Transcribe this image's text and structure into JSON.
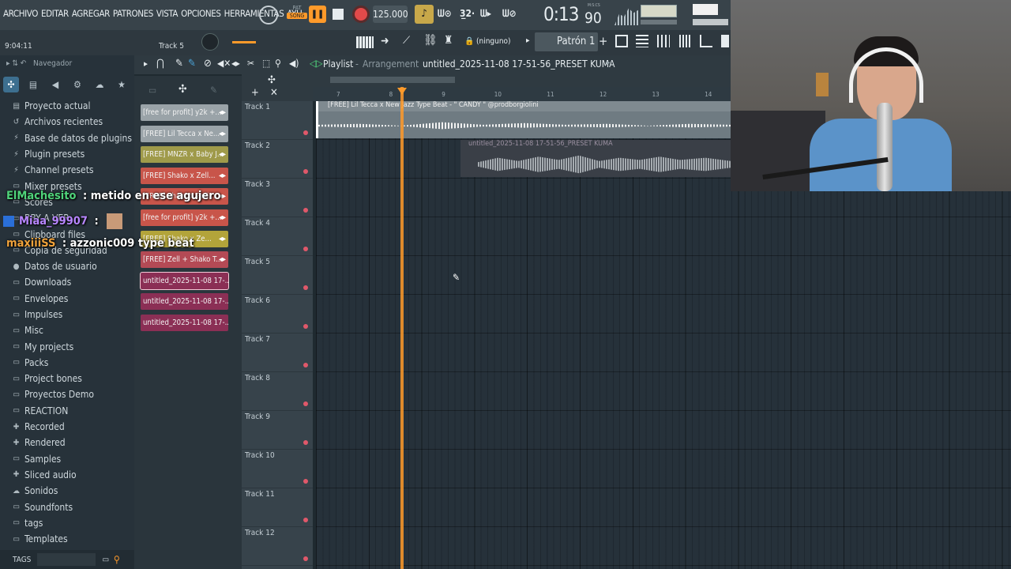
{
  "menu": [
    "ARCHIVO",
    "EDITAR",
    "AGREGAR",
    "PATRONES",
    "VISTA",
    "OPCIONES",
    "HERRAMIENTAS",
    "AYU"
  ],
  "transport": {
    "pat_label": "PAT",
    "song_label": "SONG",
    "tempo": "125.000",
    "time_display": "0:13",
    "time_small": "90",
    "time_unit": "M:S:CS"
  },
  "hint": {
    "time": "9:04:11",
    "track": "Track 5"
  },
  "toolbar": {
    "none_label": "(ninguno)",
    "pattern_label": "Patrón 1"
  },
  "browser": {
    "title": "Navegador",
    "items": [
      {
        "icon": "doc-icon",
        "label": "Proyecto actual"
      },
      {
        "icon": "history-icon",
        "label": "Archivos recientes"
      },
      {
        "icon": "plug-icon",
        "label": "Base de datos de plugins"
      },
      {
        "icon": "plug-icon",
        "label": "Plugin presets"
      },
      {
        "icon": "plug-icon",
        "label": "Channel presets"
      },
      {
        "icon": "folder-icon",
        "label": "Mixer presets"
      },
      {
        "icon": "folder-icon",
        "label": "Scores"
      },
      {
        "icon": "folder-icon",
        "label": "BBY A VER"
      },
      {
        "icon": "folder-icon",
        "label": "Clipboard files"
      },
      {
        "icon": "folder-icon",
        "label": "Copia de seguridad"
      },
      {
        "icon": "user-icon",
        "label": "Datos de usuario"
      },
      {
        "icon": "folder-icon",
        "label": "Downloads"
      },
      {
        "icon": "folder-icon",
        "label": "Envelopes"
      },
      {
        "icon": "folder-icon",
        "label": "Impulses"
      },
      {
        "icon": "folder-icon",
        "label": "Misc"
      },
      {
        "icon": "folder-icon",
        "label": "My projects"
      },
      {
        "icon": "folder-icon",
        "label": "Packs"
      },
      {
        "icon": "folder-icon",
        "label": "Project bones"
      },
      {
        "icon": "folder-icon",
        "label": "Proyectos Demo"
      },
      {
        "icon": "folder-icon",
        "label": "REACTION"
      },
      {
        "icon": "plus-icon",
        "label": "Recorded"
      },
      {
        "icon": "plus-icon",
        "label": "Rendered"
      },
      {
        "icon": "folder-icon",
        "label": "Samples"
      },
      {
        "icon": "plus-icon",
        "label": "Sliced audio"
      },
      {
        "icon": "cloud-icon",
        "label": "Sonidos"
      },
      {
        "icon": "folder-icon",
        "label": "Soundfonts"
      },
      {
        "icon": "folder-icon",
        "label": "tags"
      },
      {
        "icon": "folder-icon",
        "label": "Templates"
      }
    ],
    "tags_label": "TAGS"
  },
  "patterns": [
    {
      "label": "[free for profit] y2k +...",
      "color": "#9aa3a8"
    },
    {
      "label": "[FREE] Lil Tecca x Ne...",
      "color": "#9aa3a8"
    },
    {
      "label": "[FREE] MNZR x Baby J...",
      "color": "#9f9a4a"
    },
    {
      "label": "[FREE] Shako x Zell...",
      "color": "#c8554a"
    },
    {
      "label": "[FREE] Shako x Zell...",
      "color": "#c8554a"
    },
    {
      "label": "[free for profit] y2k +...",
      "color": "#c8554a"
    },
    {
      "label": "[FREE] Shako x Ze...",
      "color": "#b3a43a"
    },
    {
      "label": "[FREE] Zell + Shako T...",
      "color": "#b44a55"
    },
    {
      "label": "untitled_2025-11-08 17-...",
      "color": "#8b2f55"
    },
    {
      "label": "untitled_2025-11-08 17-...",
      "color": "#8b2f55"
    },
    {
      "label": "untitled_2025-11-08 17-...",
      "color": "#8b2f55"
    }
  ],
  "playlist": {
    "title": "Playlist",
    "subtitle": "Arrangement",
    "project": "untitled_2025-11-08 17-51-56_PRESET KUMA",
    "bars": [
      "7",
      "8",
      "9",
      "10",
      "11",
      "12",
      "13",
      "14"
    ],
    "tracks": [
      "Track 1",
      "Track 2",
      "Track 3",
      "Track 4",
      "Track 5",
      "Track 6",
      "Track 7",
      "Track 8",
      "Track 9",
      "Track 10",
      "Track 11",
      "Track 12"
    ],
    "clip1": "[FREE] Lil Tecca x New Jazz Type Beat - \" CANDY \" @prodborgiolini",
    "clip2": "untitled_2025-11-08 17-51-56_PRESET KUMA"
  },
  "chat": [
    {
      "user": "ElMachesito",
      "sep": " :",
      "msg": "metido en ese agujero",
      "color": "#4fd37a"
    },
    {
      "user": "Miaa_99907",
      "sep": " :",
      "msg": "",
      "color": "#b786ff"
    },
    {
      "user": "maxiiiSS",
      "sep": " :",
      "msg": "azzonic009 type beat",
      "color": "#f0a23a"
    }
  ]
}
